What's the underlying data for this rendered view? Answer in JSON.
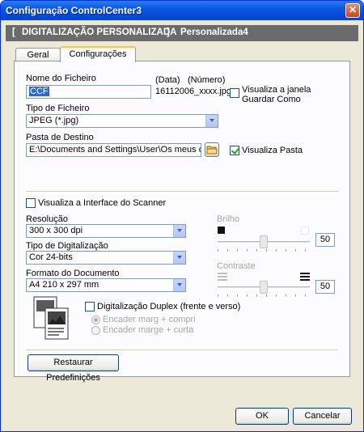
{
  "window": {
    "title": "Configuração ControlCenter3",
    "close_symbol": "✕"
  },
  "header": {
    "bracket_open": "[",
    "section": "DIGITALIZAÇÃO PERSONALIZADA",
    "bracket_close": "]",
    "profile": "Personalizada4"
  },
  "tabs": [
    {
      "label": "Geral",
      "active": false
    },
    {
      "label": "Configurações",
      "active": true
    }
  ],
  "file": {
    "name_label": "Nome do Ficheiro",
    "name_value": "CCF",
    "date_label": "(Data)",
    "number_label": "(Número)",
    "date_example": "16112006_xxxx.jpg",
    "show_save_as_label": "Visualiza a janela Guardar Como",
    "show_save_as_checked": false,
    "type_label": "Tipo de Ficheiro",
    "type_value": "JPEG (*.jpg)",
    "dest_label": "Pasta de Destino",
    "dest_value": "E:\\Documents and Settings\\User\\Os meus document",
    "show_folder_label": "Visualiza Pasta",
    "show_folder_checked": true
  },
  "scanner": {
    "show_interface_label": "Visualiza a Interface do Scanner",
    "show_interface_checked": false,
    "resolution_label": "Resolução",
    "resolution_value": "300 x 300 dpi",
    "scan_type_label": "Tipo de Digitalização",
    "scan_type_value": "Cor 24-bits",
    "doc_size_label": "Formato do Documento",
    "doc_size_value": "A4 210 x 297 mm",
    "brightness_label": "Brilho",
    "brightness_value": "50",
    "contrast_label": "Contraste",
    "contrast_value": "50",
    "duplex_label": "Digitalização Duplex (frente e verso)",
    "duplex_checked": false,
    "duplex_long_label": "Encader marg + compri",
    "duplex_short_label": "Encader marge + curta",
    "duplex_long_checked": true
  },
  "buttons": {
    "restore": "Restaurar Predefinições",
    "ok": "OK",
    "cancel": "Cancelar"
  },
  "colors": {
    "titlebar": "#0a58e0",
    "header_bar": "#6b6b6b",
    "tab_highlight": "#ffc83c",
    "field_highlight": "#316ac5"
  }
}
